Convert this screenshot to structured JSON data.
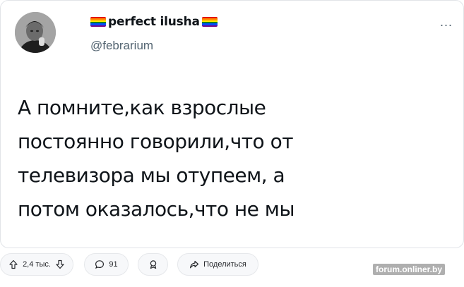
{
  "tweet": {
    "display_name": "perfect ilusha",
    "handle": "@febrarium",
    "more_label": "...",
    "flag_colors": [
      "#e40303",
      "#ff8c00",
      "#ffed00",
      "#008026",
      "#004dff",
      "#750787"
    ],
    "text_lines": [
      "А помните,как взрослые",
      "постоянно говорили,что от",
      "телевизора мы отупеем, а",
      "потом оказалось,что не мы"
    ]
  },
  "actions": {
    "rating": {
      "value": "2,4 тыс.",
      "up_icon": "arrow-up-icon",
      "down_icon": "arrow-down-icon"
    },
    "comments": {
      "count": "91",
      "icon": "comment-icon"
    },
    "award": {
      "icon": "award-icon"
    },
    "share": {
      "label": "Поделиться",
      "icon": "share-icon"
    }
  },
  "watermark": {
    "text": "forum.onliner.by"
  }
}
